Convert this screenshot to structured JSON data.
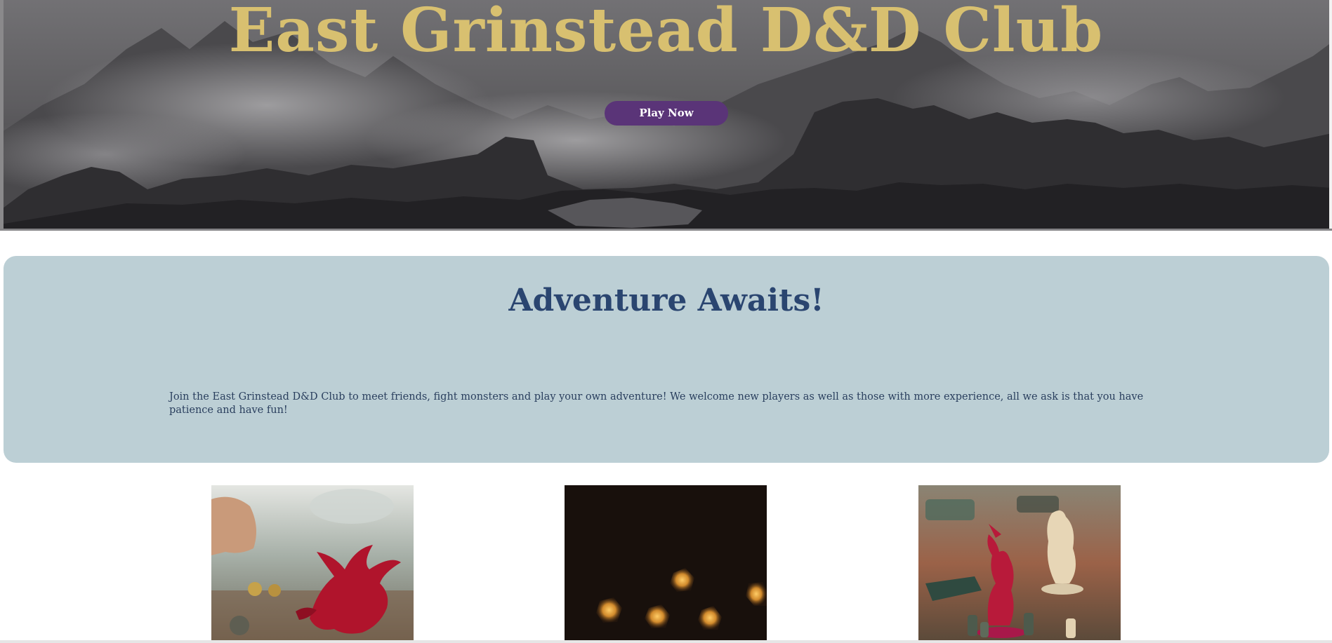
{
  "hero": {
    "title": "East Grinstead D&D Club",
    "button_label": "Play Now"
  },
  "adventure": {
    "heading": "Adventure Awaits!",
    "text": "Join the East Grinstead D&D Club to meet friends, fight monsters and play your own adventure! We welcome new players as well as those with more experience, all we ask is that you have patience and have fun!"
  },
  "colors": {
    "title_gold": "#d8c070",
    "button_purple": "#5a3478",
    "panel_blue": "#bccfd5",
    "heading_navy": "#2a4570"
  },
  "gallery": [
    {
      "subject": "red-dragon-miniature"
    },
    {
      "subject": "glowing-dice"
    },
    {
      "subject": "red-monster-miniature"
    }
  ]
}
